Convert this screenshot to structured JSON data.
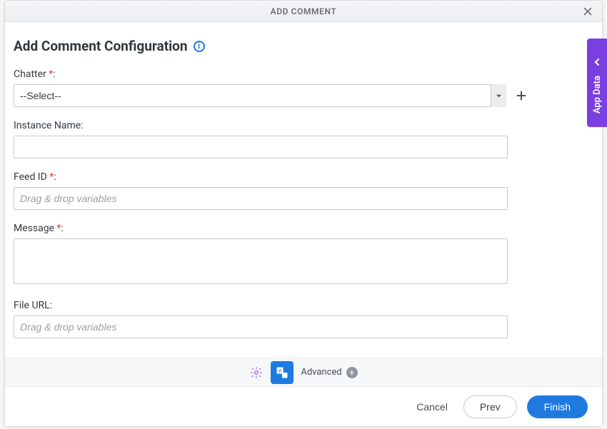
{
  "titlebar": {
    "title": "ADD COMMENT"
  },
  "heading": "Add Comment Configuration",
  "side_tab": {
    "label": "App Data"
  },
  "fields": {
    "chatter": {
      "label": "Chatter",
      "required": "*",
      "colon": ":",
      "value": "--Select--"
    },
    "instance": {
      "label": "Instance Name:",
      "value": ""
    },
    "feedid": {
      "label": "Feed ID",
      "required": "*",
      "colon": ":",
      "placeholder": "Drag & drop variables",
      "value": ""
    },
    "message": {
      "label": "Message",
      "required": "*",
      "colon": ":",
      "value": ""
    },
    "fileurl": {
      "label": "File URL:",
      "placeholder": "Drag & drop variables",
      "value": ""
    }
  },
  "toolbar": {
    "advanced": "Advanced"
  },
  "footer": {
    "cancel": "Cancel",
    "prev": "Prev",
    "finish": "Finish"
  }
}
